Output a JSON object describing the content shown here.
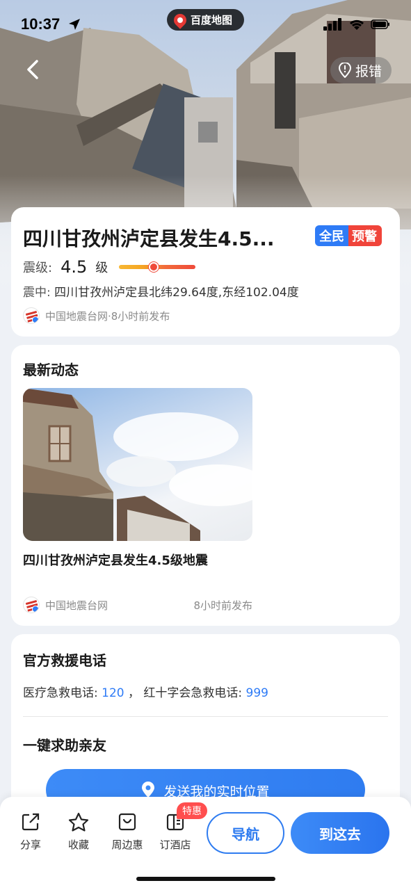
{
  "status_bar": {
    "time": "10:37"
  },
  "app_logo": {
    "label": "百度地图"
  },
  "header": {
    "report_label": "报错"
  },
  "earthquake": {
    "title": "四川甘孜州泸定县发生4.5...",
    "alert_badge": {
      "part1": "全民",
      "part2": "预警"
    },
    "magnitude_label": "震级:",
    "magnitude_value": "4.5",
    "magnitude_unit": "级",
    "magnitude_scale_fraction": 0.45,
    "epicenter_label": "震中:",
    "epicenter_value": "四川甘孜州泸定县北纬29.64度,东经102.04度",
    "source": "中国地震台网·8小时前发布"
  },
  "news": {
    "section_title": "最新动态",
    "item_title": "四川甘孜州泸定县发生4.5级地震",
    "source": "中国地震台网",
    "time": "8小时前发布"
  },
  "rescue": {
    "section_title": "官方救援电话",
    "medical_label": "医疗急救电话: ",
    "medical_number": "120",
    "separator": " ，  ",
    "redcross_label": "红十字会急救电话: ",
    "redcross_number": "999",
    "sos_title": "一键求助亲友",
    "send_location_label": "发送我的实时位置"
  },
  "bottom_bar": {
    "items": [
      {
        "label": "分享",
        "icon": "share-icon"
      },
      {
        "label": "收藏",
        "icon": "star-icon"
      },
      {
        "label": "周边惠",
        "icon": "coupon-icon"
      },
      {
        "label": "订酒店",
        "icon": "hotel-icon"
      }
    ],
    "sale_tag": "特惠",
    "nav_label": "导航",
    "go_label": "到这去"
  }
}
